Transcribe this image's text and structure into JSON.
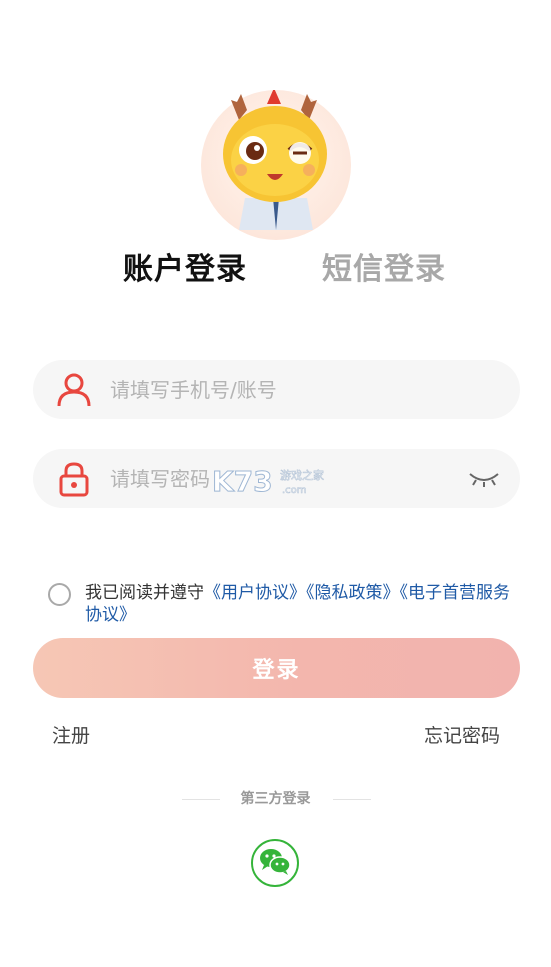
{
  "tabs": {
    "account_login": "账户登录",
    "sms_login": "短信登录"
  },
  "form": {
    "phone_placeholder": "请填写手机号/账号",
    "password_placeholder": "请填写密码"
  },
  "agreement": {
    "prefix": "我已阅读并遵守",
    "user_agreement": "《用户协议》",
    "privacy_policy": "《隐私政策》",
    "e_service_agreement": "《电子首营服务协议》"
  },
  "buttons": {
    "login": "登录",
    "register": "注册",
    "forgot_password": "忘记密码"
  },
  "third_party": {
    "label": "第三方登录"
  },
  "icons": {
    "user": "user-icon",
    "lock": "lock-icon",
    "eye": "eye-closed-icon",
    "wechat": "wechat-icon"
  },
  "colors": {
    "accent": "#e8473f",
    "link": "#1f5aa6",
    "wechat": "#35b43a"
  }
}
